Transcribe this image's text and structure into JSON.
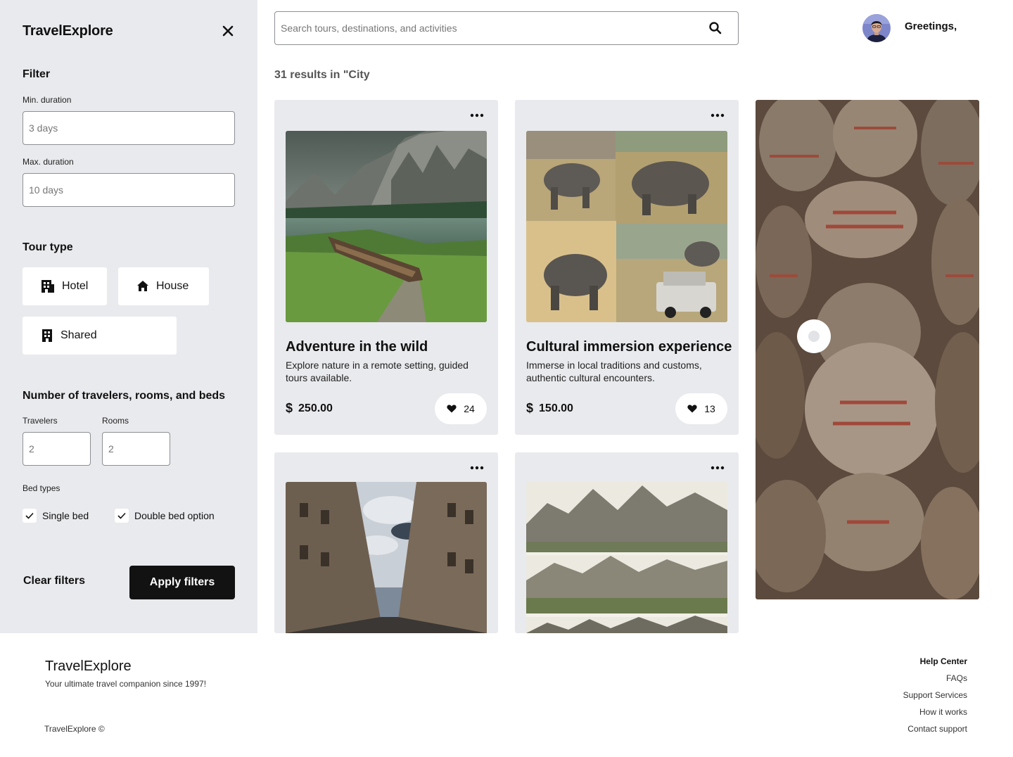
{
  "sidebar": {
    "brand": "TravelExplore",
    "filter_title": "Filter",
    "min_duration": {
      "label": "Min. duration",
      "placeholder": "3 days"
    },
    "max_duration": {
      "label": "Max. duration",
      "placeholder": "10 days"
    },
    "tour_type_title": "Tour type",
    "tour_types": [
      {
        "label": "Hotel",
        "icon": "hotel-icon"
      },
      {
        "label": "House",
        "icon": "house-icon"
      },
      {
        "label": "Shared",
        "icon": "building-icon"
      }
    ],
    "travelers_title": "Number of travelers, rooms, and beds",
    "travelers": {
      "label": "Travelers",
      "placeholder": "2"
    },
    "rooms": {
      "label": "Rooms",
      "placeholder": "2"
    },
    "bed_types_label": "Bed types",
    "bed_types": [
      {
        "label": "Single bed",
        "checked": true
      },
      {
        "label": "Double bed option",
        "checked": true
      }
    ],
    "clear_label": "Clear filters",
    "apply_label": "Apply filters"
  },
  "header": {
    "search_placeholder": "Search tours, destinations, and activities",
    "greeting": "Greetings,"
  },
  "results_text": "31 results in \"City",
  "cards": [
    {
      "title": "Adventure in the wild",
      "description": "Explore nature in a remote setting, guided tours available.",
      "price": "250.00",
      "currency_icon": "dollar-icon",
      "likes": "24"
    },
    {
      "title": "Cultural immersion experience",
      "description": "Immerse in local traditions and customs, authentic cultural encounters.",
      "price": "150.00",
      "currency_icon": "dollar-icon",
      "likes": "13"
    }
  ],
  "footer": {
    "brand": "TravelExplore",
    "tagline": "Your ultimate travel companion since 1997!",
    "copyright": "TravelExplore ©",
    "links_title": "Help Center",
    "links": [
      "FAQs",
      "Support Services",
      "How it works",
      "Contact support"
    ]
  },
  "colors": {
    "sidebar_bg": "#e9eaed",
    "card_bg": "#e9eaed",
    "primary_button": "#121212"
  }
}
